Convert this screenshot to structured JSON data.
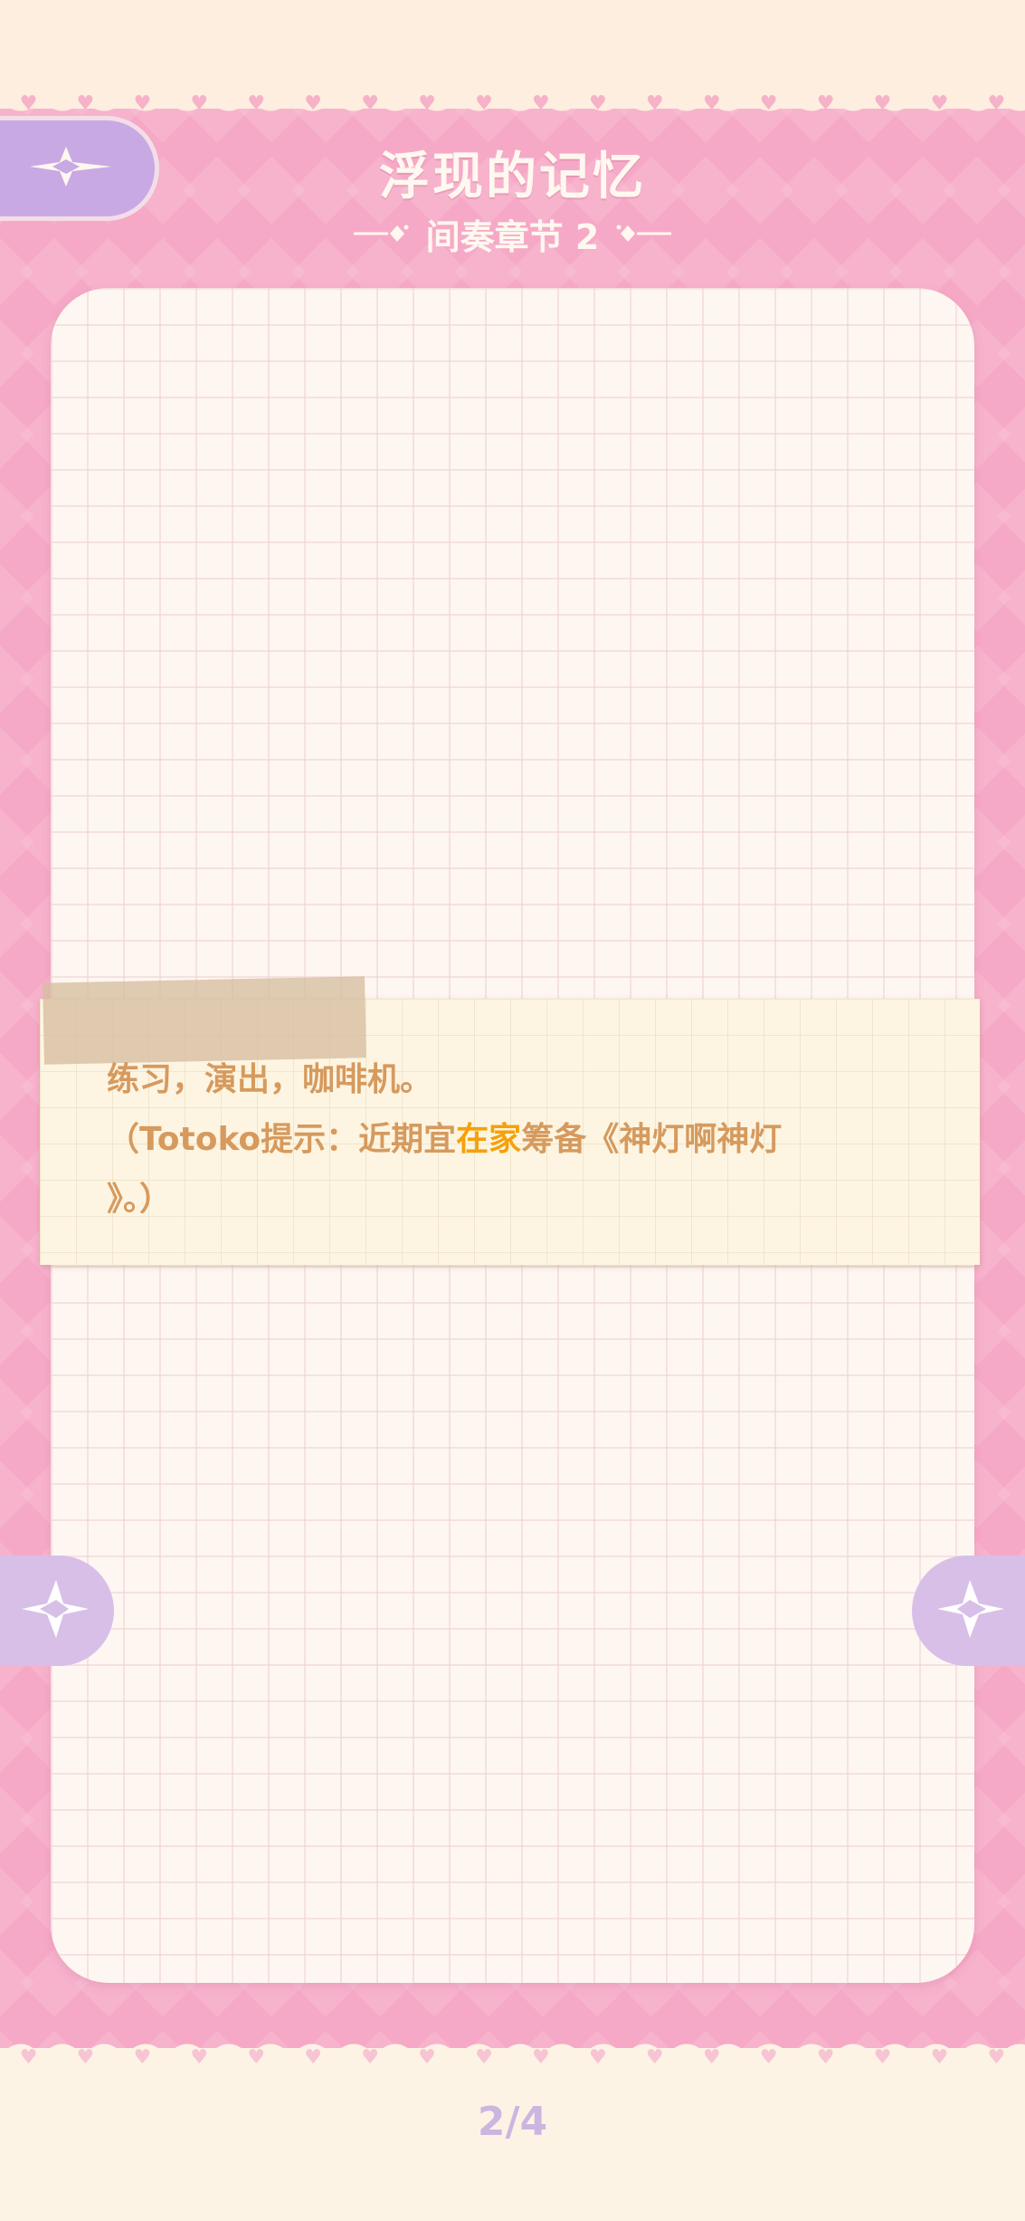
{
  "header": {
    "title": "浮现的记忆",
    "subtitle": "间奏章节 2"
  },
  "note": {
    "line1": "练习，演出，咖啡机。",
    "line2_before": "（Totoko提示：近期宜",
    "line2_highlight": "在家",
    "line2_after": "筹备《神灯啊神灯",
    "line3": "》。）",
    "highlight_color": "#f5a10a",
    "text_color": "#d69a5e"
  },
  "pagination": {
    "counter": "2/4"
  },
  "icons": {
    "back": "sparkle-back-icon",
    "prev": "sparkle-left-arrow-icon",
    "next": "sparkle-right-arrow-icon"
  },
  "colors": {
    "pink_background": "#f6a9c6",
    "cream": "#fdf3e4",
    "lavender": "#c9a9e4"
  }
}
